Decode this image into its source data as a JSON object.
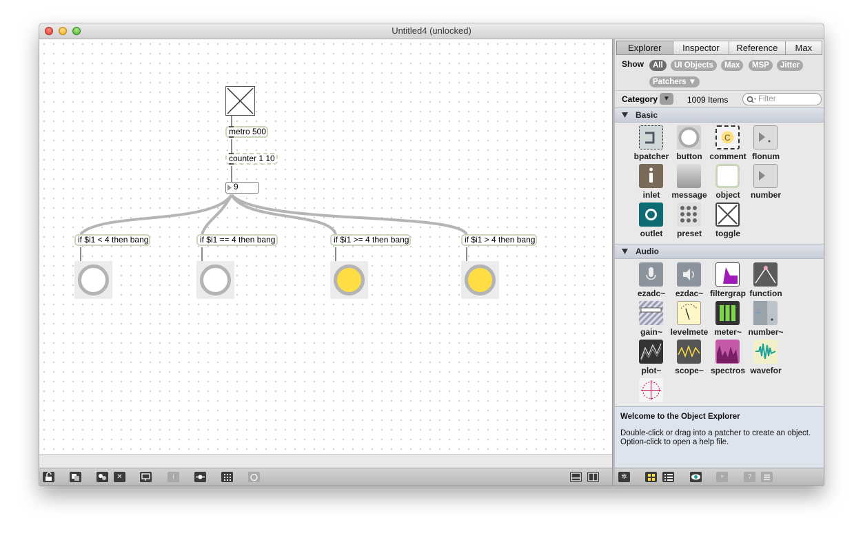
{
  "window": {
    "title": "Untitled4 (unlocked)"
  },
  "patch": {
    "toggle_name": "toggle",
    "metro": "metro 500",
    "counter": "counter 1 10",
    "number_value": "9",
    "conditions": [
      {
        "text": "if $i1 < 4 then bang",
        "bang_on": false
      },
      {
        "text": "if $i1 == 4 then bang",
        "bang_on": false
      },
      {
        "text": "if $i1 >= 4 then bang",
        "bang_on": true
      },
      {
        "text": "if $i1 > 4 then bang",
        "bang_on": true
      }
    ],
    "bang_active_color": "#ffdd44"
  },
  "sidebar": {
    "tabs": [
      "Explorer",
      "Inspector",
      "Reference",
      "Max"
    ],
    "active_tab": "Explorer",
    "show_label": "Show",
    "filters": [
      "All",
      "UI Objects",
      "Max",
      "MSP",
      "Jitter",
      "Patchers ▼"
    ],
    "category_label": "Category",
    "category_toggle": "▼",
    "items_count": "1009 Items",
    "filter_placeholder": "Filter",
    "sections": [
      {
        "name": "Basic",
        "items": [
          "bpatcher",
          "button",
          "comment",
          "flonum",
          "inlet",
          "message",
          "object",
          "number",
          "outlet",
          "preset",
          "toggle"
        ]
      },
      {
        "name": "Audio",
        "items": [
          "ezadc~",
          "ezdac~",
          "filtergrap",
          "function",
          "gain~",
          "levelmete",
          "meter~",
          "number~",
          "plot~",
          "scope~",
          "spectros",
          "wavefor",
          ""
        ]
      }
    ],
    "welcome_title": "Welcome to the Object Explorer",
    "welcome_line1": "Double-click or drag into a patcher to create an object.",
    "welcome_line2": "Option-click to open a help file."
  },
  "icons": {
    "toolbar": [
      "lock-icon",
      "new-object-icon",
      "palette-icon",
      "clear-icon",
      "presentation-icon",
      "info-icon",
      "patch-cord-icon",
      "grid-icon",
      "debug-icon",
      "split-horizontal-icon",
      "split-vertical-icon"
    ],
    "sidebar_toolbar": [
      "gear-icon",
      "grid-view-icon",
      "list-view-icon",
      "eye-icon",
      "add-icon",
      "help-icon",
      "menu-icon"
    ],
    "filter_search": "search-icon",
    "section_toggle": "triangle-down-icon"
  },
  "toolbar_glyphs": {
    "info": "i",
    "clear": "✕",
    "gear": "✲",
    "add": "+",
    "help": "?"
  }
}
